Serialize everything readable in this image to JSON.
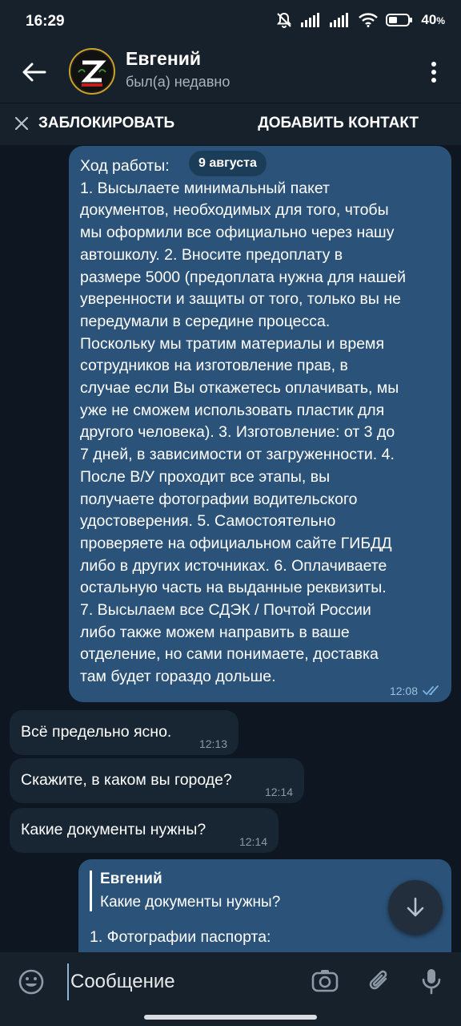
{
  "status_bar": {
    "time": "16:29",
    "battery": "40",
    "battery_unit": "%"
  },
  "header": {
    "title": "Евгений",
    "subtitle": "был(а) недавно"
  },
  "action_bar": {
    "block_label": "ЗАБЛОКИРОВАТЬ",
    "add_contact_label": "ДОБАВИТЬ КОНТАКТ"
  },
  "messages": {
    "outgoing_long": {
      "heading": "Ход работы:",
      "date_chip": "9 августа",
      "body": "1. Высылаете минимальный пакет\nдокументов, необходимых для того, чтобы\nмы оформили все официально через нашу\nавтошколу. 2. Вносите предоплату в\nразмере 5000 (предоплата нужна для нашей\nуверенности и защиты от того, только вы не\nпередумали в середине процесса.\nПоскольку мы тратим материалы и время\nсотрудников на изготовление прав, в\nслучае если Вы откажетесь оплачивать, мы\nуже не сможем использовать пластик для\nдругого человека). 3. Изготовление: от 3 до\n7 дней, в зависимости от загруженности. 4.\nПосле В/У проходит все этапы, вы\nполучаете фотографии водительского\nудостоверения. 5. Самостоятельно\nпроверяете на официальном сайте ГИБДД\nлибо в других источниках. 6. Оплачиваете\nостальную часть на выданные реквизиты.\n7. Высылаем все СДЭК / Почтой России\nлибо также можем направить в ваше\nотделение, но сами понимаете, доставка\nтам будет гораздо дольше.",
      "time": "12:08"
    },
    "incoming": [
      {
        "text": "Всё предельно ясно.",
        "time": "12:13"
      },
      {
        "text": "Скажите, в каком вы городе?",
        "time": "12:14"
      },
      {
        "text": "Какие документы нужны?",
        "time": "12:14"
      }
    ],
    "reply": {
      "quote_author": "Евгений",
      "quote_text": "Какие документы нужны?",
      "text": "1. Фотографии паспорта:"
    }
  },
  "composer": {
    "placeholder": "Сообщение"
  },
  "icons": {
    "back": "arrow-left-icon",
    "more": "more-vertical-icon",
    "close": "close-icon",
    "scroll_down": "arrow-down-icon",
    "emoji": "emoji-icon",
    "camera": "camera-icon",
    "attach": "paperclip-icon",
    "mic": "microphone-icon",
    "read": "double-check-icon"
  },
  "colors": {
    "background": "#0e1621",
    "bar": "#17212b",
    "outgoing_bubble": "#2b5278",
    "incoming_bubble": "#182533"
  }
}
